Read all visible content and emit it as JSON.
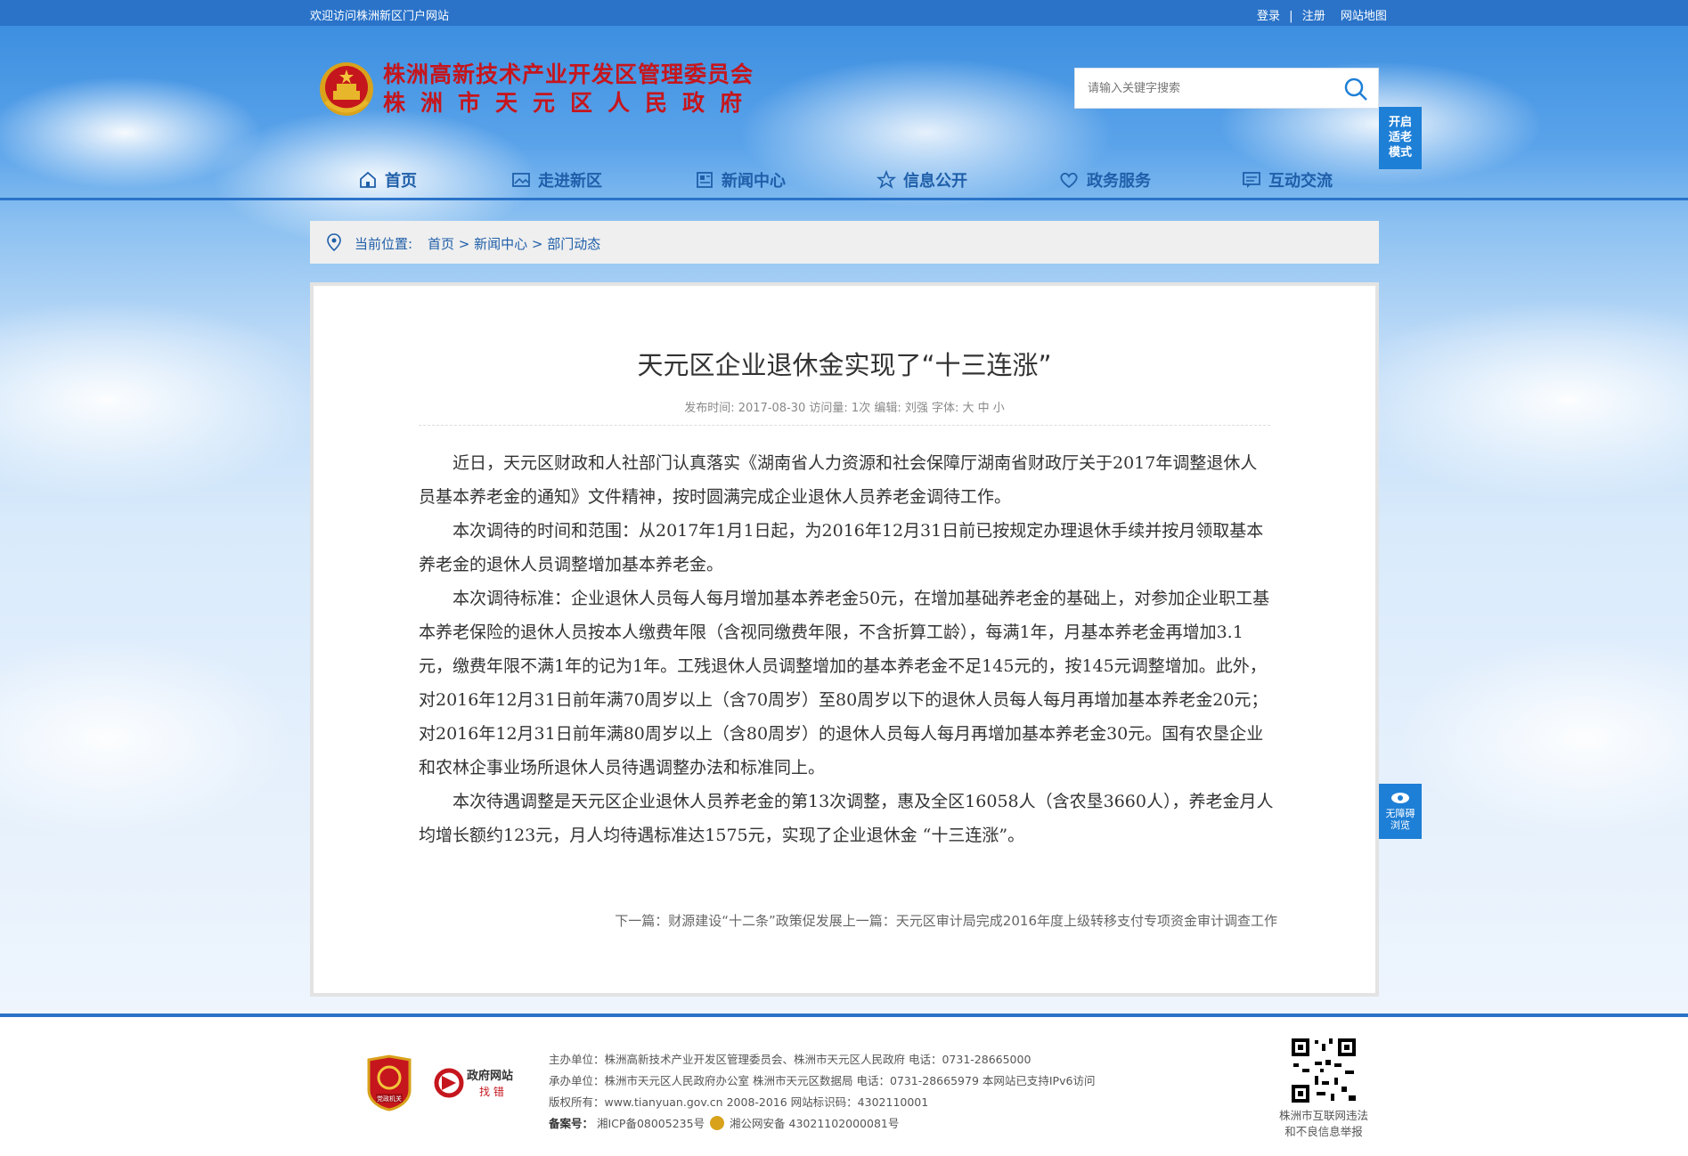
{
  "topbar": {
    "welcome": "欢迎访问株洲新区门户网站",
    "login": "登录",
    "sep": "|",
    "register": "注册",
    "sitemap": "网站地图"
  },
  "header": {
    "title_line1": "株洲高新技术产业开发区管理委员会",
    "title_line2": "株洲市天元区人民政府"
  },
  "search": {
    "placeholder": "请输入关键字搜索"
  },
  "elder_mode": {
    "l1": "开启",
    "l2": "适老",
    "l3": "模式"
  },
  "nav": {
    "items": [
      "首页",
      "走进新区",
      "新闻中心",
      "信息公开",
      "政务服务",
      "互动交流"
    ]
  },
  "breadcrumb": {
    "label": "当前位置:",
    "path": "首页 > 新闻中心 > 部门动态"
  },
  "article": {
    "title": "天元区企业退休金实现了“十三连涨”",
    "meta": "发布时间:  2017-08-30  访问量:  1次  编辑:  刘强  字体:  大 中 小",
    "paragraphs": [
      "近日，天元区财政和人社部门认真落实《湖南省人力资源和社会保障厅湖南省财政厅关于2017年调整退休人员基本养老金的通知》文件精神，按时圆满完成企业退休人员养老金调待工作。",
      "本次调待的时间和范围：从2017年1月1日起，为2016年12月31日前已按规定办理退休手续并按月领取基本养老金的退休人员调整增加基本养老金。",
      "本次调待标准：企业退休人员每人每月增加基本养老金50元，在增加基础养老金的基础上，对参加企业职工基本养老保险的退休人员按本人缴费年限（含视同缴费年限，不含折算工龄），每满1年，月基本养老金再增加3.1元，缴费年限不满1年的记为1年。工残退休人员调整增加的基本养老金不足145元的，按145元调整增加。此外，对2016年12月31日前年满70周岁以上（含70周岁）至80周岁以下的退休人员每人每月再增加基本养老金20元；对2016年12月31日前年满80周岁以上（含80周岁）的退休人员每人每月再增加基本养老金30元。国有农垦企业和农林企事业场所退休人员待遇调整办法和标准同上。",
      "本次待遇调整是天元区企业退休人员养老金的第13次调整，惠及全区16058人（含农垦3660人），养老金月人均增长额约123元，月人均待遇标准达1575元，实现了企业退休金 “十三连涨”。"
    ],
    "prev_next": "下一篇：财源建设“十二条”政策促发展上一篇：天元区审计局完成2016年度上级转移支付专项资金审计调查工作"
  },
  "accessibility": {
    "l1": "无障碍",
    "l2": "浏览"
  },
  "footer": {
    "host": "主办单位：株洲高新技术产业开发区管理委员会、株洲市天元区人民政府 电话：0731-28665000",
    "organizer": "承办单位：株洲市天元区人民政府办公室 株洲市天元区数据局 电话：0731-28665979 本网站已支持IPv6访问",
    "copyright": "版权所有：www.tianyuan.gov.cn 2008-2016 网站标识码：4302110001",
    "icp_label": "备案号：",
    "icp": "湘ICP备08005235号",
    "police": "湘公网安备 43021102000081号",
    "badge_text": "党政机关",
    "gov_site_l1": "政府网站",
    "gov_site_l2": "找 错",
    "qr_cap_l1": "株洲市互联网违法",
    "qr_cap_l2": "和不良信息举报"
  },
  "colors": {
    "brand_blue": "#2a73c9",
    "title_red": "#c5161d",
    "nav_text": "#1f5fa9"
  }
}
